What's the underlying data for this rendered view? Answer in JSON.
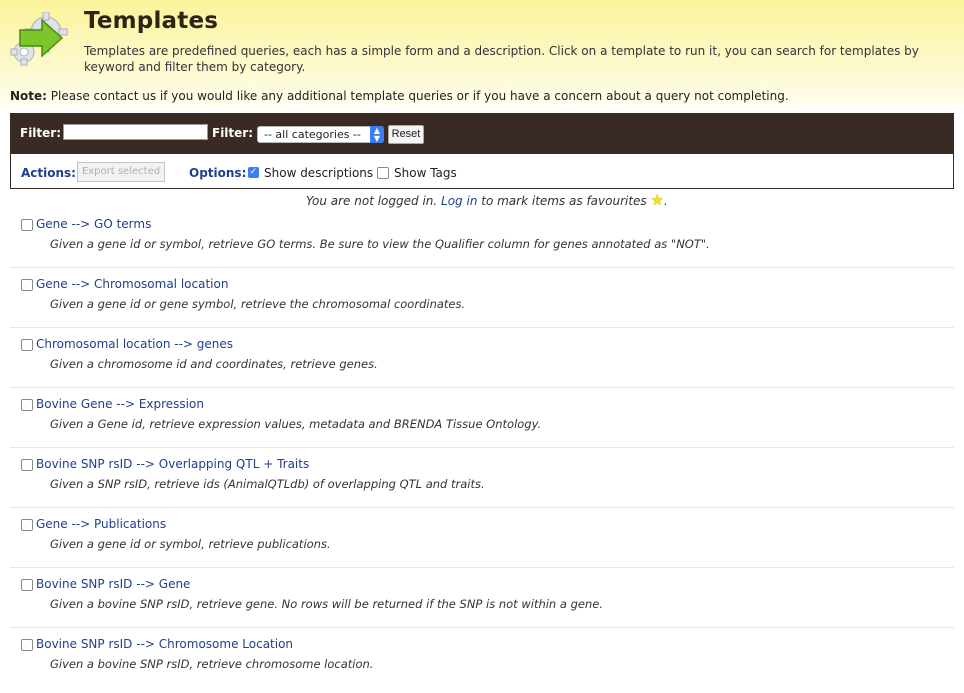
{
  "header": {
    "title": "Templates",
    "description": "Templates are predefined queries, each has a simple form and a description. Click on a template to run it, you can search for templates by keyword and filter them by category.",
    "note_label": "Note:",
    "note_text": " Please contact us if you would like any additional template queries or if you have a concern about a query not completing."
  },
  "filterbar": {
    "filter_label_1": "Filter:",
    "filter_input_value": "",
    "filter_label_2": "Filter:",
    "category_selected": "-- all categories --",
    "reset_label": "Reset"
  },
  "actionbar": {
    "actions_label": "Actions:",
    "export_label": "Export selected",
    "options_label": "Options:",
    "show_descriptions_label": "Show descriptions",
    "show_descriptions_checked": true,
    "show_tags_label": "Show Tags",
    "show_tags_checked": false
  },
  "login": {
    "prefix": "You are not logged in. ",
    "link": "Log in",
    "suffix": " to mark items as favourites ",
    "end": "."
  },
  "templates": [
    {
      "name": "Gene --> GO terms",
      "description": "Given a gene id or symbol, retrieve GO terms. Be sure to view the Qualifier column for genes annotated as \"NOT\"."
    },
    {
      "name": "Gene --> Chromosomal location",
      "description": "Given a gene id or gene symbol, retrieve the chromosomal coordinates."
    },
    {
      "name": "Chromosomal location --> genes",
      "description": "Given a chromosome id and coordinates, retrieve genes."
    },
    {
      "name": "Bovine Gene --> Expression",
      "description": "Given a Gene id, retrieve expression values, metadata and BRENDA Tissue Ontology."
    },
    {
      "name": "Bovine SNP rsID --> Overlapping QTL + Traits",
      "description": "Given a SNP rsID, retrieve ids (AnimalQTLdb) of overlapping QTL and traits."
    },
    {
      "name": "Gene --> Publications",
      "description": "Given a gene id or symbol, retrieve publications."
    },
    {
      "name": "Bovine SNP rsID --> Gene",
      "description": "Given a bovine SNP rsID, retrieve gene. No rows will be returned if the SNP is not within a gene."
    },
    {
      "name": "Bovine SNP rsID --> Chromosome Location",
      "description": "Given a bovine SNP rsID, retrieve chromosome location."
    }
  ],
  "colors": {
    "link": "#1f3f8f",
    "bar_dark": "#3a2a26",
    "header_yellow": "#fbf39a",
    "checkbox_blue": "#3a7ef0"
  },
  "icons": {
    "logo": "gear-arrow-icon",
    "favourite": "star-icon"
  }
}
